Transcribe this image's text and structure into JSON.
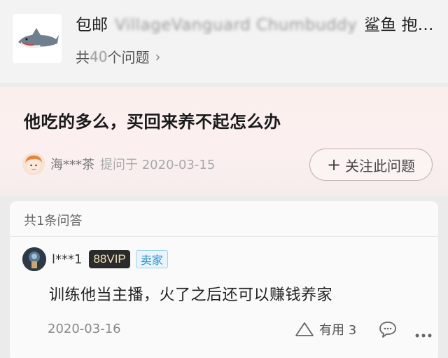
{
  "product": {
    "title_prefix": "包邮",
    "title_blurred": "VillageVanguard Chumbuddy",
    "title_suffix": "鲨鱼 抱…",
    "question_count_prefix": "共",
    "question_count_number": "40",
    "question_count_suffix": "个问题",
    "chevron": "›"
  },
  "question": {
    "text": "他吃的多么，买回来养不起怎么办",
    "asker_name": "海***茶",
    "asked_label": "提问于 2020-03-15",
    "follow_plus": "+",
    "follow_label": "关注此问题"
  },
  "answers": {
    "count_label": "共1条问答",
    "items": [
      {
        "user": "l***1",
        "vip_badge": "88VIP",
        "seller_badge": "卖家",
        "text": "训练他当主播，火了之后还可以赚钱养家",
        "date": "2020-03-16",
        "useful_label": "有用 3"
      }
    ]
  },
  "icons": {
    "chevron": "chevron-right-icon",
    "follow": "plus-icon",
    "useful": "thumbs-up-triangle-icon",
    "comment": "comment-icon",
    "more": "more-dots-icon"
  },
  "colors": {
    "question_bg": "#fbefee",
    "vip_bg": "#2b2b2b",
    "vip_text": "#f3e2b8",
    "seller_text": "#2f8fc9",
    "seller_bg": "#e8f5fc"
  }
}
